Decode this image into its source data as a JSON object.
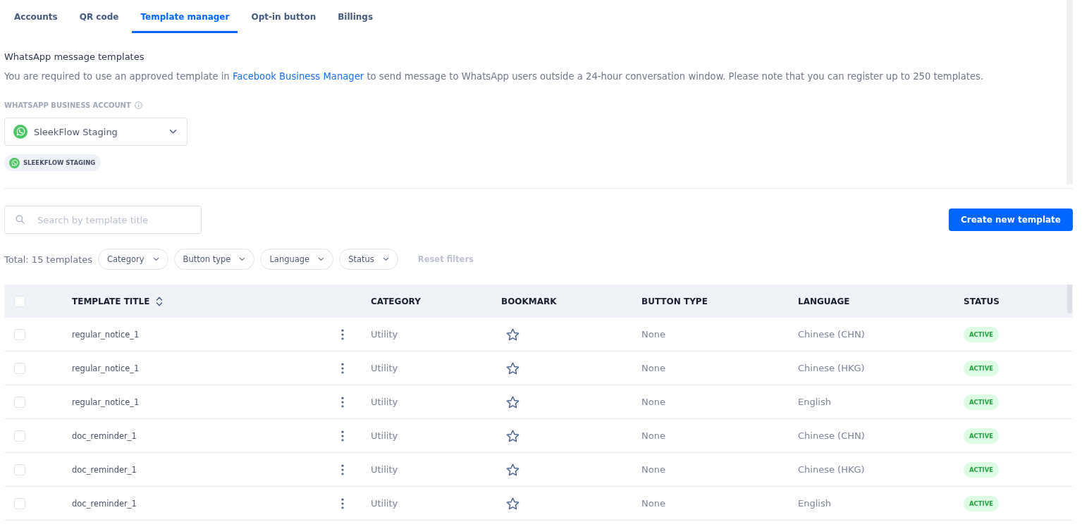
{
  "tabs": [
    {
      "label": "Accounts",
      "selected": false
    },
    {
      "label": "QR code",
      "selected": false
    },
    {
      "label": "Template manager",
      "selected": true
    },
    {
      "label": "Opt-in button",
      "selected": false
    },
    {
      "label": "Billings",
      "selected": false
    }
  ],
  "section": {
    "title": "WhatsApp message templates",
    "description_before": "You are required to use an approved template in ",
    "description_link": "Facebook Business Manager",
    "description_after": " to send message to WhatsApp users outside a 24-hour conversation window. Please note that you can register up to 250 templates."
  },
  "account": {
    "label": "WHATSAPP BUSINESS ACCOUNT",
    "value": "SleekFlow Staging",
    "tags": [
      "SLEEKFLOW STAGING"
    ]
  },
  "search": {
    "placeholder": "Search by template title"
  },
  "create_button": "Create new template",
  "filters": {
    "total": "Total: 15 templates",
    "dropdowns": [
      "Category",
      "Button type",
      "Language",
      "Status"
    ],
    "reset": {
      "label": "Reset filters",
      "disabled": true
    }
  },
  "table": {
    "all_checked": false,
    "columns": [
      {
        "label": "TEMPLATE TITLE",
        "sortable": true
      },
      {
        "label": "CATEGORY",
        "sortable": false
      },
      {
        "label": "BOOKMARK",
        "sortable": false
      },
      {
        "label": "BUTTON TYPE",
        "sortable": false
      },
      {
        "label": "LANGUAGE",
        "sortable": false
      },
      {
        "label": "STATUS",
        "sortable": false
      }
    ],
    "rows": [
      {
        "checked": false,
        "title": "regular_notice_1",
        "category": "Utility",
        "bookmarked": false,
        "button_type": "None",
        "language": "Chinese (CHN)",
        "status": "ACTIVE"
      },
      {
        "checked": false,
        "title": "regular_notice_1",
        "category": "Utility",
        "bookmarked": false,
        "button_type": "None",
        "language": "Chinese (HKG)",
        "status": "ACTIVE"
      },
      {
        "checked": false,
        "title": "regular_notice_1",
        "category": "Utility",
        "bookmarked": false,
        "button_type": "None",
        "language": "English",
        "status": "ACTIVE"
      },
      {
        "checked": false,
        "title": "doc_reminder_1",
        "category": "Utility",
        "bookmarked": false,
        "button_type": "None",
        "language": "Chinese (CHN)",
        "status": "ACTIVE"
      },
      {
        "checked": false,
        "title": "doc_reminder_1",
        "category": "Utility",
        "bookmarked": false,
        "button_type": "None",
        "language": "Chinese (HKG)",
        "status": "ACTIVE"
      },
      {
        "checked": false,
        "title": "doc_reminder_1",
        "category": "Utility",
        "bookmarked": false,
        "button_type": "None",
        "language": "English",
        "status": "ACTIVE"
      }
    ]
  }
}
